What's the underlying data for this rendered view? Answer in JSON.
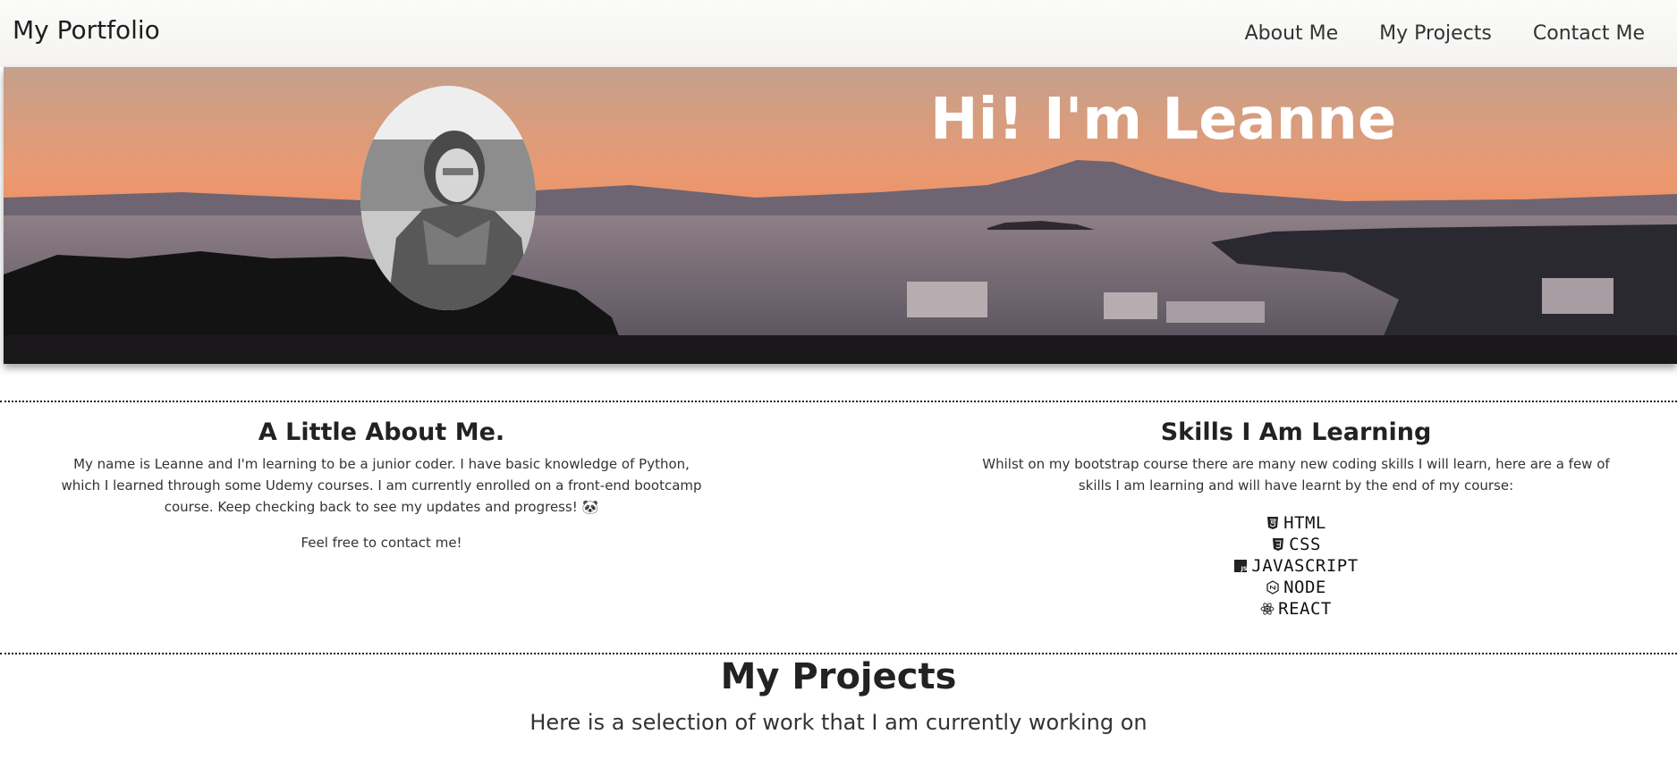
{
  "navbar": {
    "brand": "My Portfolio",
    "links": [
      "About Me",
      "My Projects",
      "Contact Me"
    ]
  },
  "hero": {
    "title": "Hi! I'm Leanne"
  },
  "about": {
    "title": "A Little About Me.",
    "text": "My name is Leanne and I'm learning to be a junior coder. I have basic knowledge of Python, which I learned through some Udemy courses. I am currently enrolled on a front-end bootcamp course. Keep checking back to see my updates and progress! 🐼",
    "contact": "Feel free to contact me!"
  },
  "skills": {
    "title": "Skills I Am Learning",
    "text": "Whilst on my bootstrap course there are many new coding skills I will learn, here are a few of skills I am learning and will have learnt by the end of my course:",
    "items": [
      {
        "label": "HTML",
        "icon": "html5-icon"
      },
      {
        "label": "CSS",
        "icon": "css3-icon"
      },
      {
        "label": "JAVASCRIPT",
        "icon": "js-icon"
      },
      {
        "label": "NODE",
        "icon": "node-icon"
      },
      {
        "label": "REACT",
        "icon": "react-icon"
      }
    ]
  },
  "projects": {
    "title": "My Projects",
    "subtitle": "Here is a selection of work that I am currently working on"
  },
  "colors": {
    "sky_top": "#c99a80",
    "sky_sun": "#f08a5a",
    "sea": "#6c6470",
    "text_dark": "#222222"
  }
}
